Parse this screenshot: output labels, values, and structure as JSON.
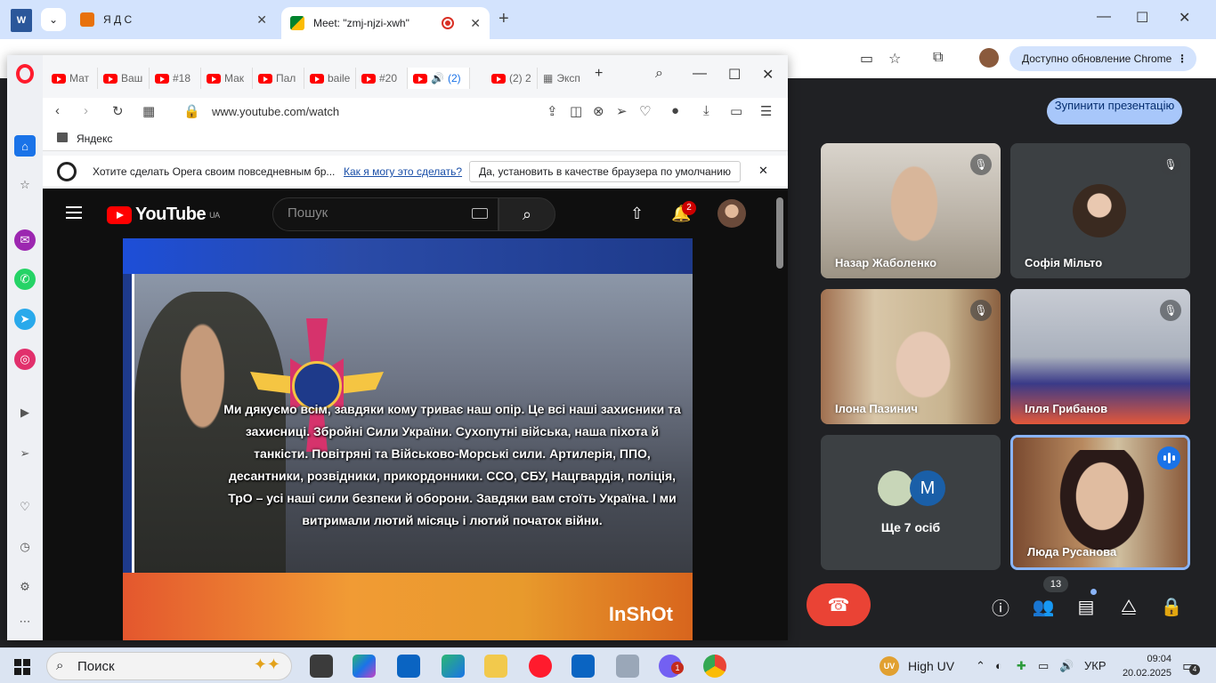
{
  "chrome": {
    "tabs": [
      {
        "title": "Я Д С"
      },
      {
        "title": "Meet: \"zmj-njzi-xwh\""
      }
    ],
    "update_label": "Доступно обновление Chrome"
  },
  "meet": {
    "stop_presenting": "Зупинити презентацію",
    "participants": [
      {
        "name": "Назар Жаболенко"
      },
      {
        "name": "Софія Мільто"
      },
      {
        "name": "Ілона Пазинич"
      },
      {
        "name": "Ілля Грибанов"
      },
      {
        "name": "Ще 7 осіб",
        "avatar_letter": "M"
      },
      {
        "name": "Люда Русанова"
      }
    ],
    "people_count": "13"
  },
  "opera": {
    "tabs": [
      {
        "title": "Мат"
      },
      {
        "title": "Ваш"
      },
      {
        "title": "#18"
      },
      {
        "title": "Мак"
      },
      {
        "title": "Пал"
      },
      {
        "title": "baile"
      },
      {
        "title": "#20"
      },
      {
        "title": "(2)"
      },
      {
        "title": "(2) 2"
      },
      {
        "title": "Эксп"
      }
    ],
    "url": "www.youtube.com/watch",
    "bookmark": "Яндекс",
    "default_bar": {
      "message": "Хотите сделать Opera своим повседневным бр...",
      "link": "Как я могу это сделать?",
      "button": "Да, установить в качестве браузера по умолчанию"
    }
  },
  "youtube": {
    "logo_text": "YouTube",
    "region": "UA",
    "search_placeholder": "Пошук",
    "notifications": "2",
    "video_text": "Ми дякуємо всім, завдяки кому триває наш опір. Це всі наші захисники та захисниці. Збройні Сили України. Сухопутні війська, наша піхота й танкісти. Повітряні та Військово-Морські сили. Артилерія, ППО, десантники, розвідники, прикордонники. ССО, СБУ, Нацгвардія, поліція, ТрО – усі наші сили безпеки й оборони. Завдяки вам стоїть Україна. І ми витримали лютий місяць і лютий початок війни.",
    "watermark": "InShOt"
  },
  "taskbar": {
    "search_label": "Поиск",
    "uv_badge": "UV",
    "uv_text": "High UV",
    "lang": "УКР",
    "time": "09:04",
    "date": "20.02.2025",
    "notif_count": "4",
    "viber_badge": "1"
  },
  "colors": {
    "meet_bg": "#202124",
    "youtube_bg": "#0f0f0f",
    "leave_red": "#ea4335",
    "accent_blue": "#1a73e8"
  }
}
